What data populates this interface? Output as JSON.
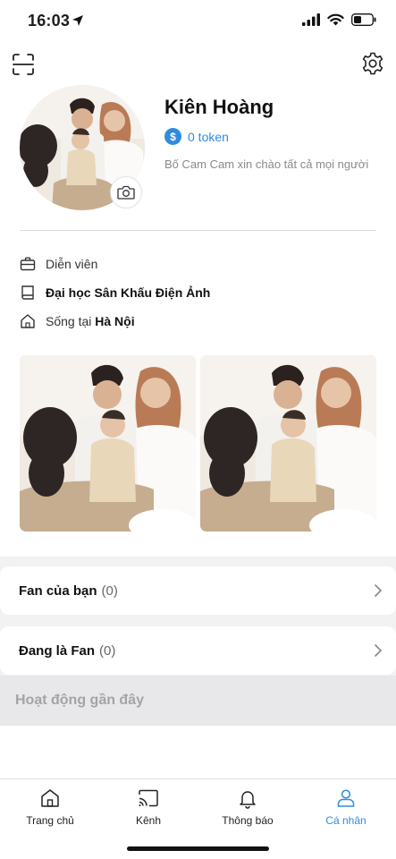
{
  "status_bar": {
    "time": "16:03"
  },
  "profile": {
    "name": "Kiên Hoàng",
    "token": "0 token",
    "token_symbol": "$",
    "bio": "Bố Cam Cam xin chào tất cả mọi người"
  },
  "info": {
    "job": "Diễn viên",
    "school": "Đại học Sân Khấu Điện Ảnh",
    "location_prefix": "Sống tại",
    "location": "Hà Nội"
  },
  "sections": {
    "fans_label": "Fan của bạn",
    "fans_count": "(0)",
    "following_label": "Đang là Fan",
    "following_count": "(0)",
    "recent_label": "Hoạt động gần đây"
  },
  "nav": {
    "items": [
      {
        "label": "Trang chủ",
        "icon": "home-icon"
      },
      {
        "label": "Kênh",
        "icon": "cast-icon"
      },
      {
        "label": "Thông báo",
        "icon": "bell-icon"
      },
      {
        "label": "Cá nhân",
        "icon": "person-icon",
        "active": true
      }
    ]
  },
  "colors": {
    "accent": "#2f8bde",
    "text": "#111111",
    "muted": "#8a8a8e",
    "section_bg": "#f2f2f3"
  }
}
